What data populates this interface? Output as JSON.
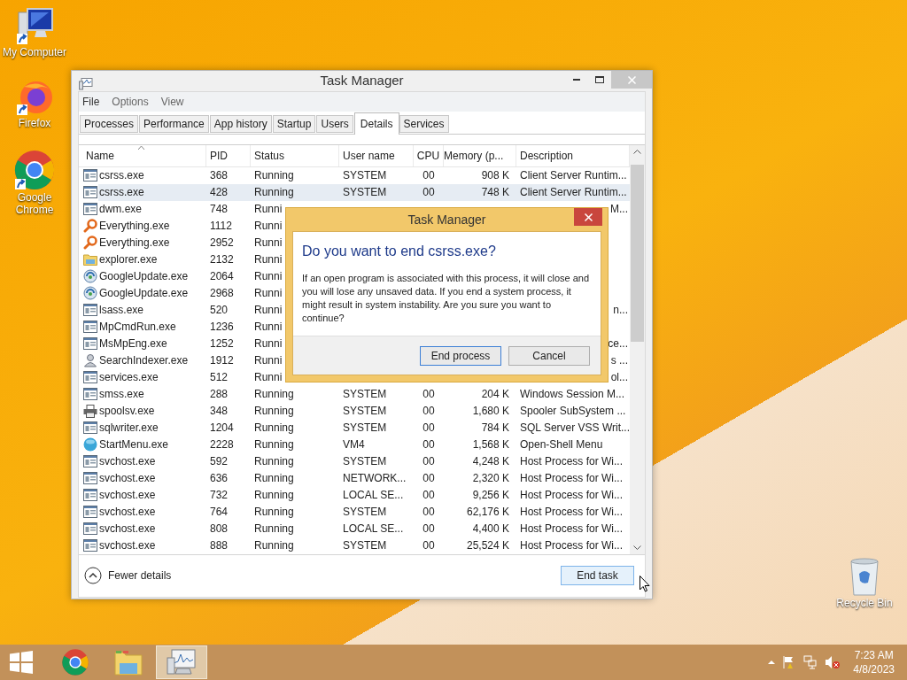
{
  "desktop_icons": [
    {
      "label": "My Computer",
      "kind": "computer"
    },
    {
      "label": "Firefox",
      "kind": "firefox"
    },
    {
      "label": "Google Chrome",
      "kind": "chrome"
    }
  ],
  "recycle_bin": {
    "label": "Recycle Bin"
  },
  "window": {
    "title": "Task Manager",
    "menu": [
      "File",
      "Options",
      "View"
    ],
    "tabs": [
      {
        "label": "Processes",
        "selected": false
      },
      {
        "label": "Performance",
        "selected": false
      },
      {
        "label": "App history",
        "selected": false
      },
      {
        "label": "Startup",
        "selected": false
      },
      {
        "label": "Users",
        "selected": false
      },
      {
        "label": "Details",
        "selected": true
      },
      {
        "label": "Services",
        "selected": false
      }
    ],
    "table": {
      "columns": [
        "Name",
        "PID",
        "Status",
        "User name",
        "CPU",
        "Memory (p...",
        "Description"
      ],
      "rows": [
        {
          "kind": "app",
          "name": "csrss.exe",
          "pid": "368",
          "status": "Running",
          "user": "SYSTEM",
          "cpu": "00",
          "memory": "908 K",
          "description": "Client Server Runtim...",
          "selected": false
        },
        {
          "kind": "app",
          "name": "csrss.exe",
          "pid": "428",
          "status": "Running",
          "user": "SYSTEM",
          "cpu": "00",
          "memory": "748 K",
          "description": "Client Server Runtim...",
          "selected": true
        },
        {
          "kind": "app",
          "name": "dwm.exe",
          "pid": "748",
          "status": "Runni",
          "description": "M...",
          "selected": false
        },
        {
          "kind": "magnifier",
          "name": "Everything.exe",
          "pid": "1112",
          "status": "Runni",
          "selected": false
        },
        {
          "kind": "magnifier",
          "name": "Everything.exe",
          "pid": "2952",
          "status": "Runni",
          "selected": false
        },
        {
          "kind": "folder",
          "name": "explorer.exe",
          "pid": "2132",
          "status": "Runni",
          "selected": false
        },
        {
          "kind": "update",
          "name": "GoogleUpdate.exe",
          "pid": "2064",
          "status": "Runni",
          "selected": false
        },
        {
          "kind": "update",
          "name": "GoogleUpdate.exe",
          "pid": "2968",
          "status": "Runni",
          "selected": false
        },
        {
          "kind": "app",
          "name": "lsass.exe",
          "pid": "520",
          "status": "Runni",
          "description": "n...",
          "selected": false
        },
        {
          "kind": "app",
          "name": "MpCmdRun.exe",
          "pid": "1236",
          "status": "Runni",
          "selected": false
        },
        {
          "kind": "app",
          "name": "MsMpEng.exe",
          "pid": "1252",
          "status": "Runni",
          "description": "ce...",
          "selected": false
        },
        {
          "kind": "person",
          "name": "SearchIndexer.exe",
          "pid": "1912",
          "status": "Runni",
          "description": "s ...",
          "selected": false
        },
        {
          "kind": "app",
          "name": "services.exe",
          "pid": "512",
          "status": "Runni",
          "description": "ol...",
          "selected": false
        },
        {
          "kind": "app",
          "name": "smss.exe",
          "pid": "288",
          "status": "Running",
          "user": "SYSTEM",
          "cpu": "00",
          "memory": "204 K",
          "description": "Windows Session M...",
          "selected": false
        },
        {
          "kind": "printer",
          "name": "spoolsv.exe",
          "pid": "348",
          "status": "Running",
          "user": "SYSTEM",
          "cpu": "00",
          "memory": "1,680 K",
          "description": "Spooler SubSystem ...",
          "selected": false
        },
        {
          "kind": "app",
          "name": "sqlwriter.exe",
          "pid": "1204",
          "status": "Running",
          "user": "SYSTEM",
          "cpu": "00",
          "memory": "784 K",
          "description": "SQL Server VSS Writ...",
          "selected": false
        },
        {
          "kind": "globe",
          "name": "StartMenu.exe",
          "pid": "2228",
          "status": "Running",
          "user": "VM4",
          "cpu": "00",
          "memory": "1,568 K",
          "description": "Open-Shell Menu",
          "selected": false
        },
        {
          "kind": "app",
          "name": "svchost.exe",
          "pid": "592",
          "status": "Running",
          "user": "SYSTEM",
          "cpu": "00",
          "memory": "4,248 K",
          "description": "Host Process for Wi...",
          "selected": false
        },
        {
          "kind": "app",
          "name": "svchost.exe",
          "pid": "636",
          "status": "Running",
          "user": "NETWORK...",
          "cpu": "00",
          "memory": "2,320 K",
          "description": "Host Process for Wi...",
          "selected": false
        },
        {
          "kind": "app",
          "name": "svchost.exe",
          "pid": "732",
          "status": "Running",
          "user": "LOCAL SE...",
          "cpu": "00",
          "memory": "9,256 K",
          "description": "Host Process for Wi...",
          "selected": false
        },
        {
          "kind": "app",
          "name": "svchost.exe",
          "pid": "764",
          "status": "Running",
          "user": "SYSTEM",
          "cpu": "00",
          "memory": "62,176 K",
          "description": "Host Process for Wi...",
          "selected": false
        },
        {
          "kind": "app",
          "name": "svchost.exe",
          "pid": "808",
          "status": "Running",
          "user": "LOCAL SE...",
          "cpu": "00",
          "memory": "4,400 K",
          "description": "Host Process for Wi...",
          "selected": false
        },
        {
          "kind": "app",
          "name": "svchost.exe",
          "pid": "888",
          "status": "Running",
          "user": "SYSTEM",
          "cpu": "00",
          "memory": "25,524 K",
          "description": "Host Process for Wi...",
          "selected": false
        }
      ]
    },
    "fewer_details": "Fewer details",
    "end_task": "End task"
  },
  "dialog": {
    "title": "Task Manager",
    "heading": "Do you want to end csrss.exe?",
    "body": "If an open program is associated with this process, it will close and you will lose any unsaved data. If you end a system process, it might result in system instability. Are you sure you want to continue?",
    "buttons": [
      {
        "label": "End process",
        "default": true
      },
      {
        "label": "Cancel",
        "default": false
      }
    ]
  },
  "taskbar": {
    "apps": [
      {
        "kind": "chrome",
        "active": false
      },
      {
        "kind": "explorer",
        "active": false
      },
      {
        "kind": "taskmgr",
        "active": true
      }
    ],
    "time": "7:23 AM",
    "date": "4/8/2023"
  }
}
